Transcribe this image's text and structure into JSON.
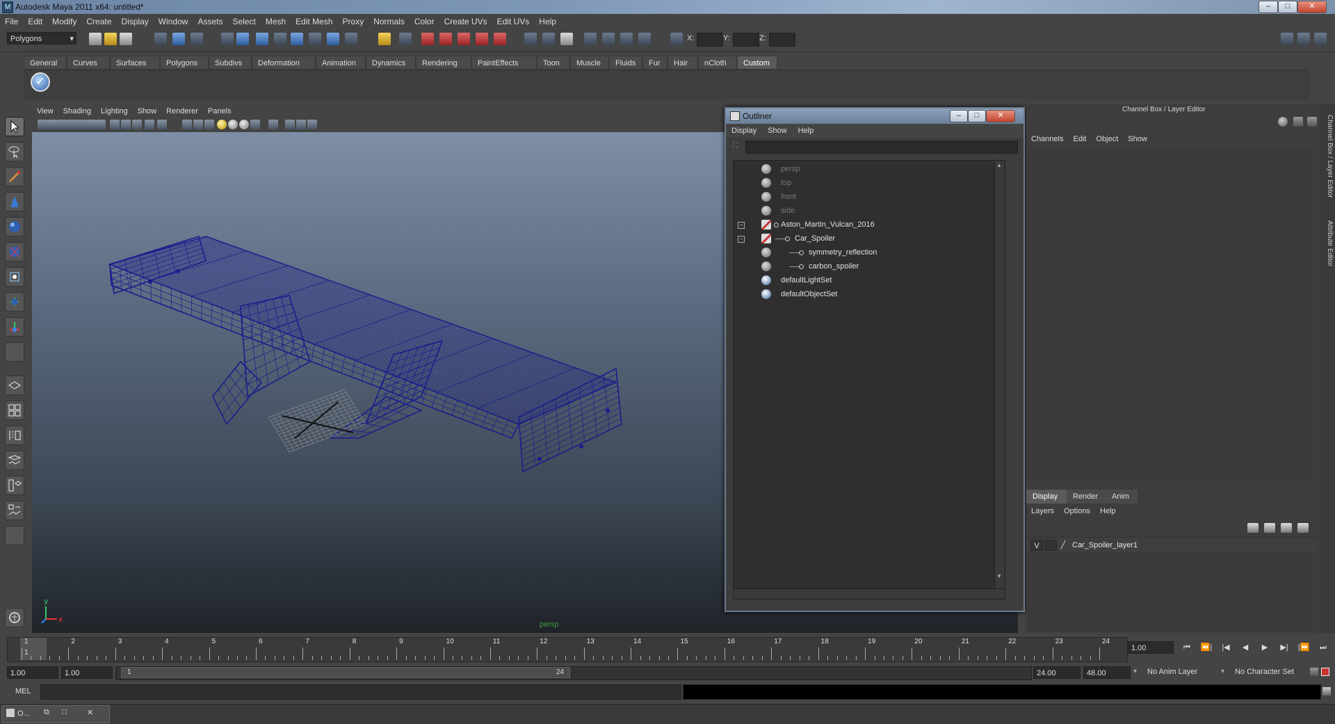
{
  "window": {
    "title": "Autodesk Maya 2011 x64: untitled*",
    "app_icon": "maya-icon",
    "controls": {
      "minimize": "–",
      "maximize": "□",
      "close": "✕"
    }
  },
  "menubar": [
    "File",
    "Edit",
    "Modify",
    "Create",
    "Display",
    "Window",
    "Assets",
    "Select",
    "Mesh",
    "Edit Mesh",
    "Proxy",
    "Normals",
    "Color",
    "Create UVs",
    "Edit UVs",
    "Help"
  ],
  "statusline": {
    "mode": "Polygons",
    "coord_labels": [
      "X:",
      "Y:",
      "Z:"
    ]
  },
  "shelf": {
    "tabs": [
      "General",
      "Curves",
      "Surfaces",
      "Polygons",
      "Subdivs",
      "Deformation",
      "Animation",
      "Dynamics",
      "Rendering",
      "PaintEffects",
      "Toon",
      "Muscle",
      "Fluids",
      "Fur",
      "Hair",
      "nCloth",
      "Custom"
    ],
    "active_tab": "Custom",
    "button_icon": "checkmark-icon"
  },
  "viewport": {
    "menu": [
      "View",
      "Shading",
      "Lighting",
      "Show",
      "Renderer",
      "Panels"
    ],
    "camera_label": "persp",
    "axis": {
      "y": "y",
      "x": "x"
    },
    "wire_color": "#1c1c8c"
  },
  "outliner": {
    "title": "Outliner",
    "menu": [
      "Display",
      "Show",
      "Help"
    ],
    "items": [
      {
        "label": "persp",
        "dim": true,
        "indent": 0,
        "icon": "camera-icon"
      },
      {
        "label": "top",
        "dim": true,
        "indent": 0,
        "icon": "camera-icon"
      },
      {
        "label": "front",
        "dim": true,
        "indent": 0,
        "icon": "camera-icon"
      },
      {
        "label": "side",
        "dim": true,
        "indent": 0,
        "icon": "camera-icon"
      },
      {
        "label": "Aston_Martin_Vulcan_2016",
        "dim": false,
        "indent": 0,
        "icon": "transform-icon",
        "expander": "−"
      },
      {
        "label": "Car_Spoiler",
        "dim": false,
        "indent": 1,
        "icon": "transform-icon",
        "expander": "−"
      },
      {
        "label": "symmetry_reflection",
        "dim": false,
        "indent": 2,
        "icon": "mesh-icon"
      },
      {
        "label": "carbon_spoiler",
        "dim": false,
        "indent": 2,
        "icon": "mesh-icon"
      },
      {
        "label": "defaultLightSet",
        "dim": false,
        "indent": 0,
        "icon": "set-icon"
      },
      {
        "label": "defaultObjectSet",
        "dim": false,
        "indent": 0,
        "icon": "set-icon"
      }
    ]
  },
  "channelbox": {
    "title": "Channel Box / Layer Editor",
    "menu": [
      "Channels",
      "Edit",
      "Object",
      "Show"
    ],
    "layer_tabs": [
      "Display",
      "Render",
      "Anim"
    ],
    "active_layer_tab": "Display",
    "layer_menu": [
      "Layers",
      "Options",
      "Help"
    ],
    "layers": [
      {
        "visible": "V",
        "name": "Car_Spoiler_layer1"
      }
    ]
  },
  "side_tabs": [
    "Channel Box / Layer Editor",
    "Attribute Editor"
  ],
  "timeslider": {
    "frames": [
      1,
      2,
      3,
      4,
      5,
      6,
      7,
      8,
      9,
      10,
      11,
      12,
      13,
      14,
      15,
      16,
      17,
      18,
      19,
      20,
      21,
      22,
      23,
      24
    ],
    "current_frame": "1",
    "current_frame_field": "1.00"
  },
  "playback": [
    "⏮",
    "⏪|",
    "|◀",
    "◀",
    "▶",
    "▶|",
    "|⏩",
    "⏭"
  ],
  "range": {
    "start": "1.00",
    "playback_start": "1.00",
    "handle_start": "1",
    "handle_end": "24",
    "playback_end": "24.00",
    "end": "48.00",
    "anim_layer": "No Anim Layer",
    "character_set": "No Character Set"
  },
  "cmdline": {
    "label": "MEL"
  },
  "taskbar": {
    "window_label": "O..."
  }
}
